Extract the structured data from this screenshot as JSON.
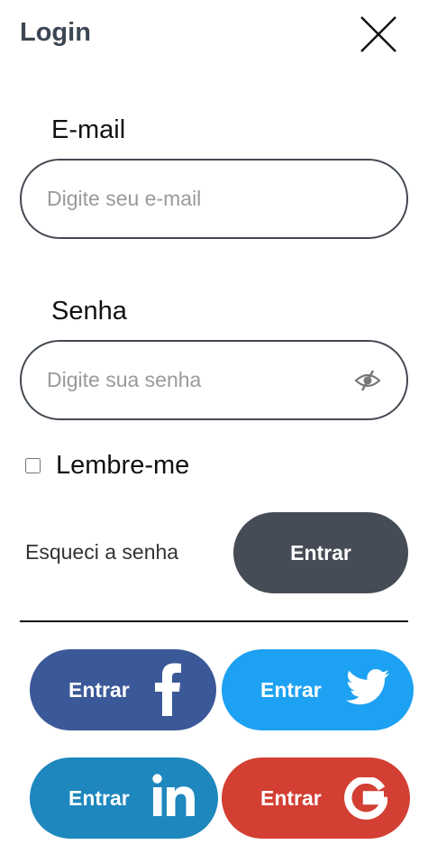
{
  "header": {
    "title": "Login",
    "close_icon": "close-icon"
  },
  "form": {
    "email": {
      "label": "E-mail",
      "value": "",
      "placeholder": "Digite seu e-mail"
    },
    "password": {
      "label": "Senha",
      "value": "",
      "placeholder": "Digite sua senha",
      "toggle_icon": "eye-slash-icon"
    },
    "remember": {
      "label": "Lembre-me",
      "checked": false
    },
    "forgot_link": "Esqueci a senha",
    "submit_label": "Entrar"
  },
  "social": [
    {
      "provider": "facebook",
      "label": "Entrar",
      "icon": "facebook-icon",
      "color": "#3b5898"
    },
    {
      "provider": "twitter",
      "label": "Entrar",
      "icon": "twitter-icon",
      "color": "#1da1f2"
    },
    {
      "provider": "linkedin",
      "label": "Entrar",
      "icon": "linkedin-icon",
      "color": "#1e87be"
    },
    {
      "provider": "google",
      "label": "Entrar",
      "icon": "google-icon",
      "color": "#d33f33"
    }
  ],
  "colors": {
    "primary_button": "#464c55",
    "title": "#3d4753",
    "input_border": "#444a52"
  }
}
